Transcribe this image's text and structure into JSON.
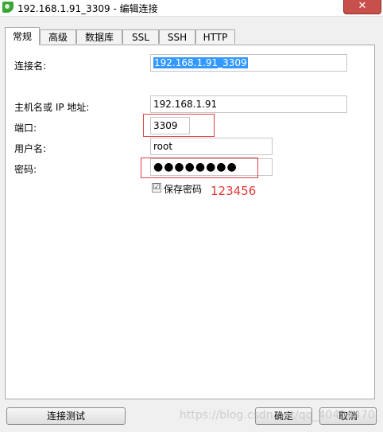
{
  "window": {
    "title": "192.168.1.91_3309 - 编辑连接",
    "close_glyph": "✕",
    "app_icon": "navicat-logo-icon"
  },
  "tabs": [
    {
      "label": "常规",
      "active": true
    },
    {
      "label": "高级",
      "active": false
    },
    {
      "label": "数据库",
      "active": false
    },
    {
      "label": "SSL",
      "active": false
    },
    {
      "label": "SSH",
      "active": false
    },
    {
      "label": "HTTP",
      "active": false
    }
  ],
  "form": {
    "connection_name_label": "连接名:",
    "connection_name_value": "192.168.1.91_3309",
    "host_label": "主机名或 IP 地址:",
    "host_value": "192.168.1.91",
    "port_label": "端口:",
    "port_value": "3309",
    "username_label": "用户名:",
    "username_value": "root",
    "password_label": "密码:",
    "password_value": "●●●●●●●●",
    "save_password_label": "保存密码",
    "save_password_checked": true,
    "check_glyph": "☑"
  },
  "annotation": {
    "password_hint": "123456",
    "color": "#e13a3a"
  },
  "buttons": {
    "test_connection": "连接测试",
    "ok": "确定",
    "cancel": "取消"
  },
  "watermark": "https://blog.csdn.net/qq_40436470"
}
